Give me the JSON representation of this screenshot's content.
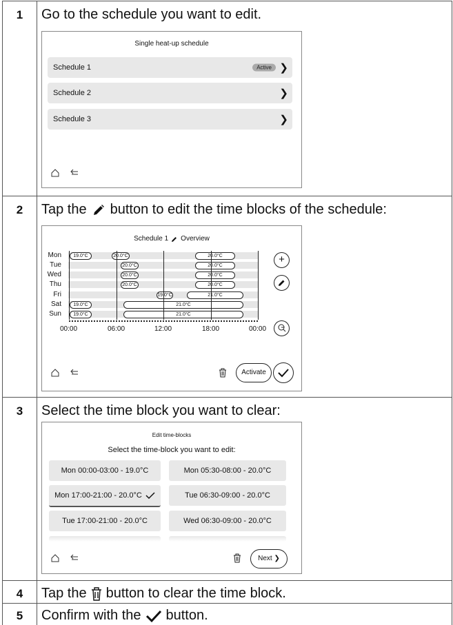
{
  "steps": [
    {
      "num": "1",
      "text": "Go to the schedule you want to edit."
    },
    {
      "num": "2",
      "text_before": "Tap the",
      "text_after": "button to edit the time blocks of the schedule:"
    },
    {
      "num": "3",
      "text": "Select the time block you want to clear:"
    },
    {
      "num": "4",
      "text_before": "Tap the",
      "text_after": "button to clear the time block."
    },
    {
      "num": "5",
      "text_before": "Confirm with the",
      "text_after": "button."
    }
  ],
  "screen1": {
    "title": "Single heat-up schedule",
    "items": [
      {
        "label": "Schedule 1",
        "badge": "Active"
      },
      {
        "label": "Schedule 2"
      },
      {
        "label": "Schedule 3"
      }
    ],
    "home_icon": "home-icon",
    "back_icon": "back-icon"
  },
  "screen2": {
    "title": "Schedule 1",
    "title_suffix": "Overview",
    "days": [
      "Mon",
      "Tue",
      "Wed",
      "Thu",
      "Fri",
      "Sat",
      "Sun"
    ],
    "blocks": [
      [
        "19.0°C",
        "20.0°C",
        "20.0°C"
      ],
      [
        "20.0°C",
        "20.0°C"
      ],
      [
        "20.0°C",
        "20.0°C"
      ],
      [
        "20.0°C",
        "20.0°C"
      ],
      [
        "19.0°C",
        "21.0°C"
      ],
      [
        "19.0°C",
        "21.0°C"
      ],
      [
        "19.0°C",
        "21.0°C"
      ]
    ],
    "times": [
      "00:00",
      "06:00",
      "12:00",
      "18:00",
      "00:00"
    ],
    "activate_label": "Activate"
  },
  "screen3": {
    "title": "Edit time-blocks",
    "subtitle": "Select the time-block you want to edit:",
    "blocks": [
      "Mon 00:00-03:00 - 19.0°C",
      "Mon 05:30-08:00 - 20.0°C",
      "Mon 17:00-21:00 - 20.0°C",
      "Tue 06:30-09:00 - 20.0°C",
      "Tue 17:00-21:00 - 20.0°C",
      "Wed 06:30-09:00 - 20.0°C"
    ],
    "selected_index": 2,
    "next_label": "Next"
  }
}
